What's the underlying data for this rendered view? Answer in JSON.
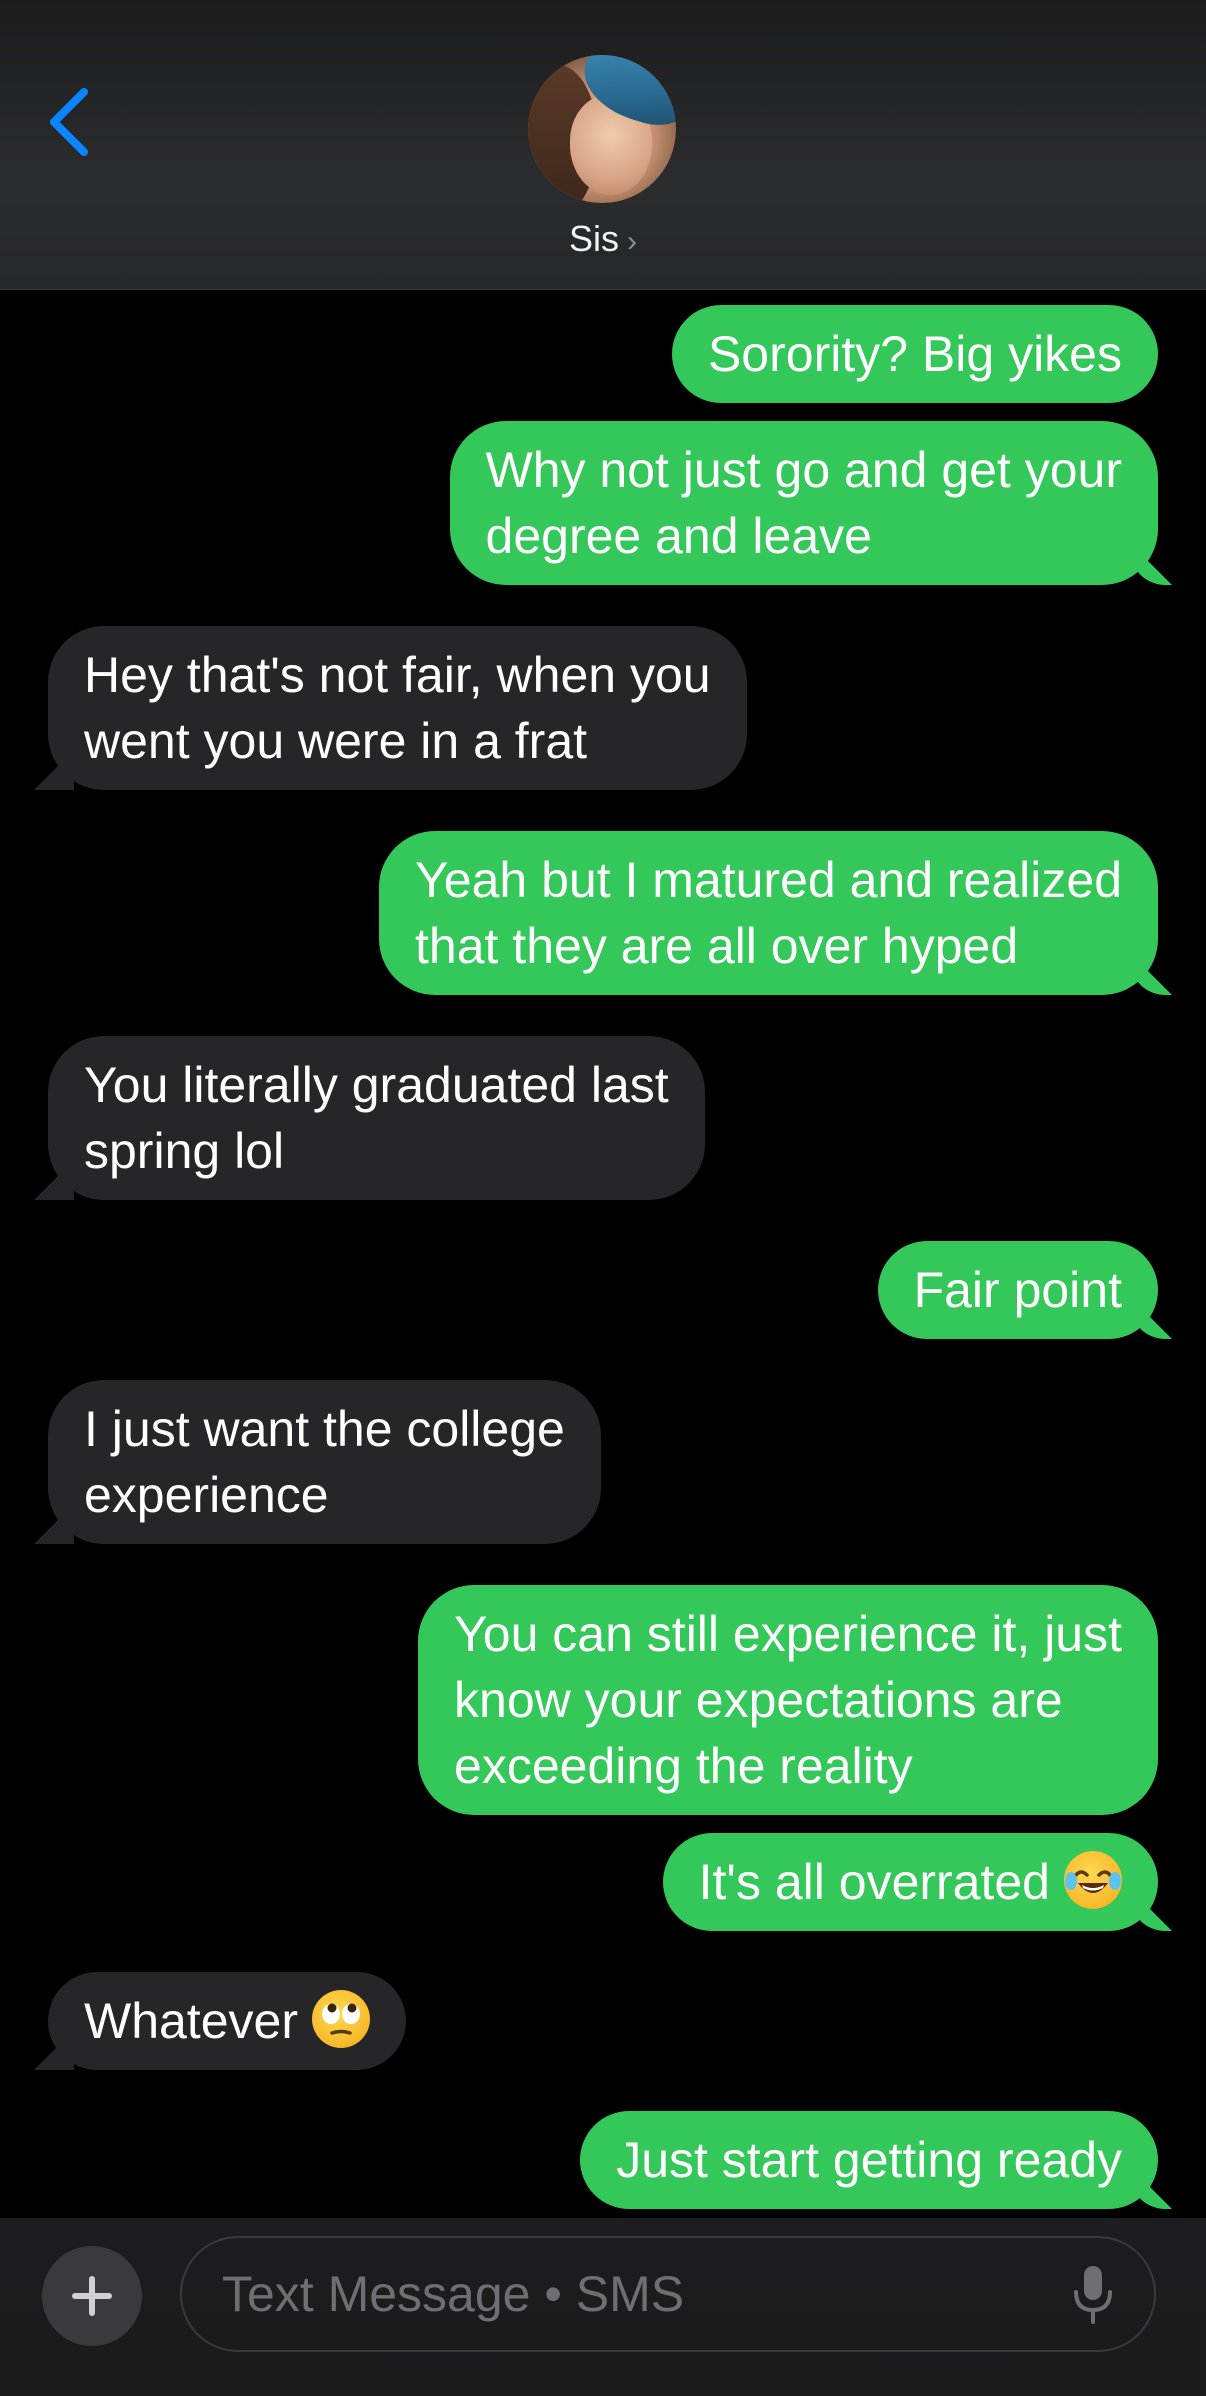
{
  "header": {
    "contact_name": "Sis",
    "chevron": "›"
  },
  "messages": [
    {
      "id": "m1",
      "from": "me",
      "text": "Sorority? Big yikes"
    },
    {
      "id": "m2",
      "from": "me",
      "line1": "Why not just go and get your",
      "line2": "degree and leave"
    },
    {
      "id": "m3",
      "from": "them",
      "line1": "Hey that's not fair, when you",
      "line2": "went you were in a frat"
    },
    {
      "id": "m4",
      "from": "me",
      "line1": "Yeah but I matured and realized",
      "line2": "that they are all over hyped"
    },
    {
      "id": "m5",
      "from": "them",
      "line1": "You literally graduated last",
      "line2": "spring lol"
    },
    {
      "id": "m6",
      "from": "me",
      "text": "Fair point"
    },
    {
      "id": "m7",
      "from": "them",
      "line1": "I just want the college",
      "line2": "experience"
    },
    {
      "id": "m8",
      "from": "me",
      "line1": "You can still experience it, just",
      "line2": "know your expectations are",
      "line3": "exceeding the reality"
    },
    {
      "id": "m9",
      "from": "me",
      "text": "It's all overrated",
      "emoji": "face-with-tears-of-joy"
    },
    {
      "id": "m10",
      "from": "them",
      "text": "Whatever",
      "emoji": "face-with-rolling-eyes"
    },
    {
      "id": "m11",
      "from": "me",
      "text": "Just start getting ready"
    }
  ],
  "composer": {
    "placeholder": "Text Message • SMS"
  },
  "icons": {
    "back": "chevron-left-icon",
    "add": "plus-icon",
    "mic": "microphone-icon"
  },
  "colors": {
    "sent_bubble": "#34c759",
    "received_bubble": "#262628",
    "accent": "#0a84ff"
  }
}
